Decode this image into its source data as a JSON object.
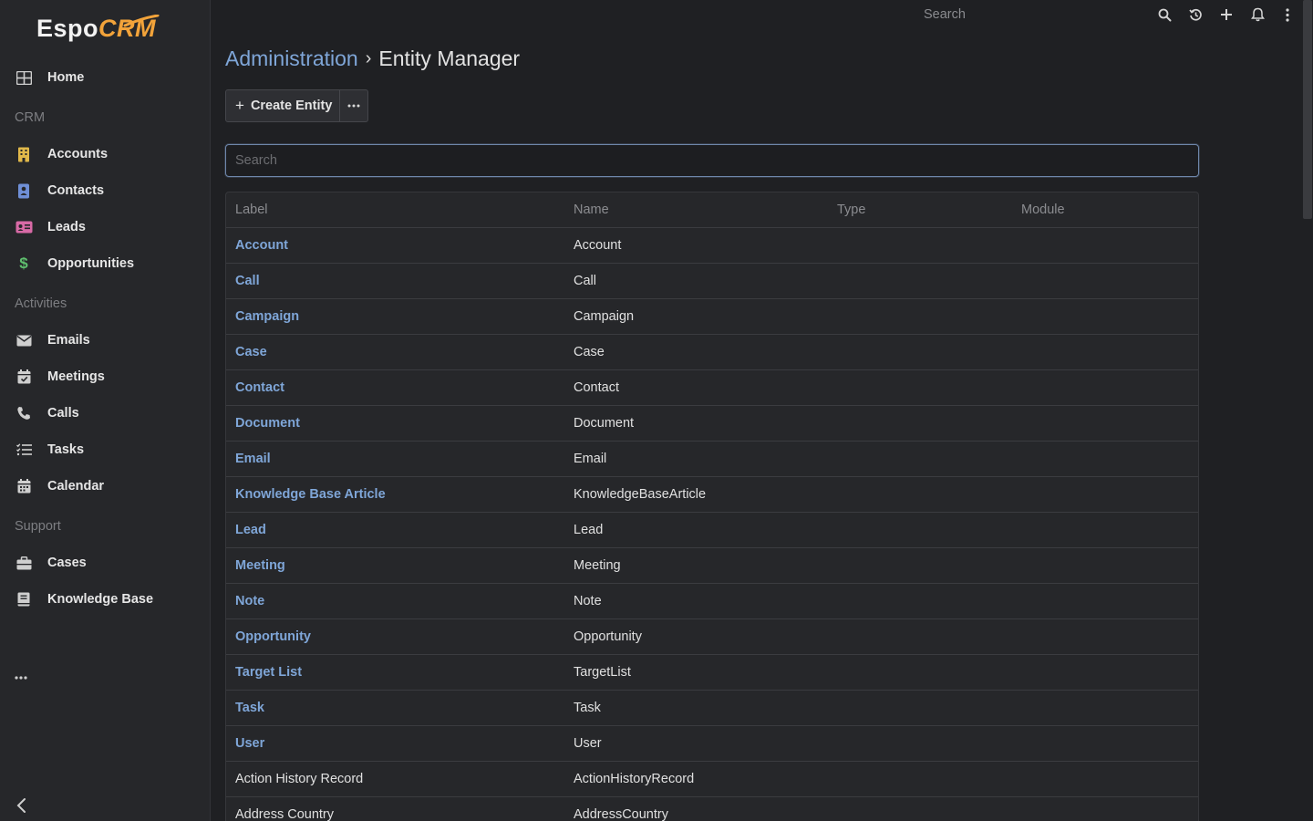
{
  "app": {
    "logo_main": "Espo",
    "logo_accent": "CRM"
  },
  "sidebar": {
    "home": "Home",
    "groups": {
      "crm": "CRM",
      "activities": "Activities",
      "support": "Support"
    },
    "crm_items": [
      "Accounts",
      "Contacts",
      "Leads",
      "Opportunities"
    ],
    "activity_items": [
      "Emails",
      "Meetings",
      "Calls",
      "Tasks",
      "Calendar"
    ],
    "support_items": [
      "Cases",
      "Knowledge Base"
    ],
    "more": "···"
  },
  "topbar": {
    "search_placeholder": "Search"
  },
  "header": {
    "breadcrumb_parent": "Administration",
    "breadcrumb_sep": "›",
    "title": "Entity Manager"
  },
  "toolbar": {
    "create_label": "Create Entity",
    "create_plus": "+",
    "more_label": "···"
  },
  "filter": {
    "placeholder": "Search"
  },
  "table": {
    "columns": [
      "Label",
      "Name",
      "Type",
      "Module"
    ],
    "rows": [
      {
        "label": "Account",
        "name": "Account",
        "link": true
      },
      {
        "label": "Call",
        "name": "Call",
        "link": true
      },
      {
        "label": "Campaign",
        "name": "Campaign",
        "link": true
      },
      {
        "label": "Case",
        "name": "Case",
        "link": true
      },
      {
        "label": "Contact",
        "name": "Contact",
        "link": true
      },
      {
        "label": "Document",
        "name": "Document",
        "link": true
      },
      {
        "label": "Email",
        "name": "Email",
        "link": true
      },
      {
        "label": "Knowledge Base Article",
        "name": "KnowledgeBaseArticle",
        "link": true
      },
      {
        "label": "Lead",
        "name": "Lead",
        "link": true
      },
      {
        "label": "Meeting",
        "name": "Meeting",
        "link": true
      },
      {
        "label": "Note",
        "name": "Note",
        "link": true
      },
      {
        "label": "Opportunity",
        "name": "Opportunity",
        "link": true
      },
      {
        "label": "Target List",
        "name": "TargetList",
        "link": true
      },
      {
        "label": "Task",
        "name": "Task",
        "link": true
      },
      {
        "label": "User",
        "name": "User",
        "link": true
      },
      {
        "label": "Action History Record",
        "name": "ActionHistoryRecord",
        "link": false
      },
      {
        "label": "Address Country",
        "name": "AddressCountry",
        "link": false
      }
    ]
  },
  "colors": {
    "link": "#7fa6d8",
    "accent_logo": "#f2a33a",
    "accounts_icon": "#e0b84a",
    "contacts_icon": "#6f8fd6",
    "leads_icon": "#d86aa6",
    "opportunities_icon": "#5fbf6e"
  }
}
